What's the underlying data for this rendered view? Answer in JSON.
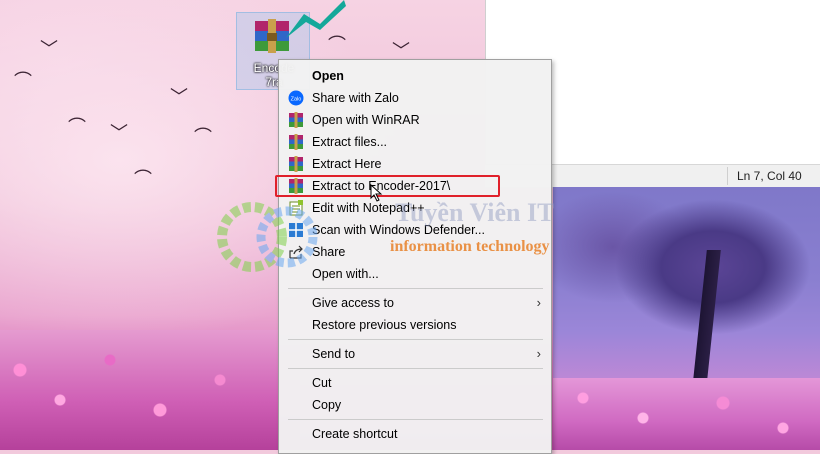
{
  "desktop": {
    "icon_label_line1": "Encode",
    "icon_label_line2": "7ra",
    "icon_name": "winrar-archive-icon"
  },
  "notepad": {
    "cursor_position": "Ln 7, Col 40"
  },
  "watermark": {
    "title": "Tuyền Viên IT",
    "subtitle": "information technology"
  },
  "context_menu": {
    "items": [
      {
        "label": "Open",
        "icon": "",
        "bold": true
      },
      {
        "label": "Share with Zalo",
        "icon": "zalo-icon"
      },
      {
        "label": "Open with WinRAR",
        "icon": "winrar-icon"
      },
      {
        "label": "Extract files...",
        "icon": "winrar-icon"
      },
      {
        "label": "Extract Here",
        "icon": "winrar-icon"
      },
      {
        "label": "Extract to Encoder-2017\\",
        "icon": "winrar-icon"
      },
      {
        "label": "Edit with Notepad++",
        "icon": "notepad-plus-icon"
      },
      {
        "label": "Scan with Windows Defender...",
        "icon": "windows-defender-icon"
      },
      {
        "label": "Share",
        "icon": "share-icon"
      },
      {
        "label": "Open with...",
        "icon": ""
      },
      {
        "label": "Give access to",
        "icon": "",
        "submenu": true
      },
      {
        "label": "Restore previous versions",
        "icon": ""
      },
      {
        "label": "Send to",
        "icon": "",
        "submenu": true
      },
      {
        "label": "Cut",
        "icon": ""
      },
      {
        "label": "Copy",
        "icon": ""
      },
      {
        "label": "Create shortcut",
        "icon": ""
      }
    ],
    "submenu_arrow": "›"
  },
  "colors": {
    "highlight_border": "#e0202a",
    "menu_bg": "#f2f2f2",
    "teal_arrow": "#14a89a"
  }
}
